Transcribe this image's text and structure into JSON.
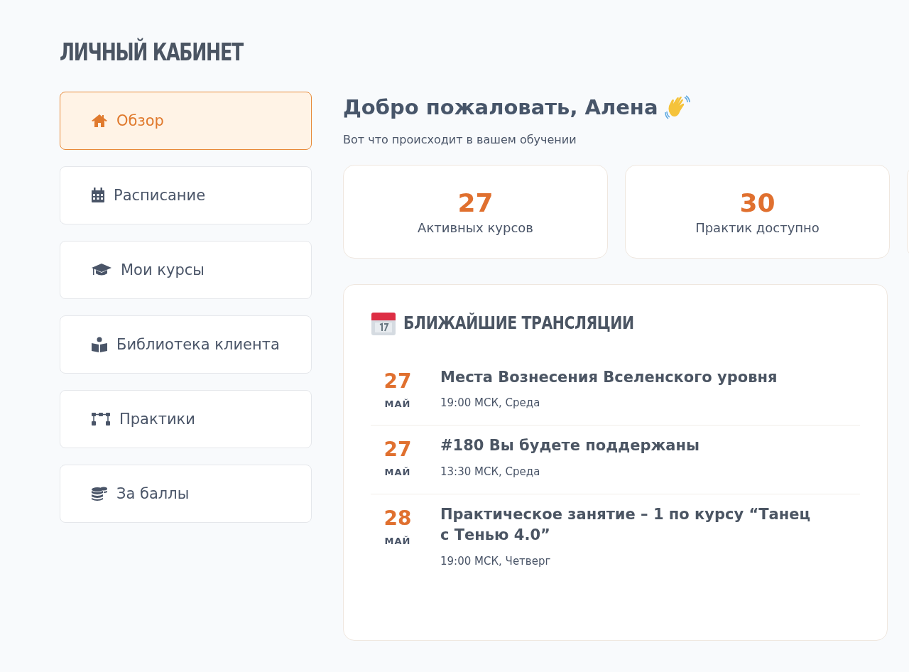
{
  "page_title": "ЛИЧНЫЙ КАБИНЕТ",
  "sidebar": {
    "items": [
      {
        "label": "Обзор",
        "kind": "home",
        "selected": true
      },
      {
        "label": "Расписание",
        "kind": "calendar",
        "selected": false
      },
      {
        "label": "Мои курсы",
        "kind": "cap",
        "selected": false
      },
      {
        "label": "Библиотека клиента",
        "kind": "reader",
        "selected": false
      },
      {
        "label": "Практики",
        "kind": "nodes",
        "selected": false
      },
      {
        "label": "За баллы",
        "kind": "coins",
        "selected": false
      }
    ]
  },
  "welcome": {
    "title": "Добро пожаловать, Алена",
    "subtitle": "Вот что происходит в вашем обучении"
  },
  "stats": [
    {
      "value": "27",
      "label": "Активных курсов"
    },
    {
      "value": "30",
      "label": "Практик доступно"
    }
  ],
  "broadcasts": {
    "title": "БЛИЖАЙШИЕ ТРАНСЛЯЦИИ",
    "events": [
      {
        "day": "27",
        "month": "МАЙ",
        "title": "Места Вознесения Вселенского уровня",
        "time": "19:00 МСК, Среда"
      },
      {
        "day": "27",
        "month": "МАЙ",
        "title": "#180 Вы будете поддержаны",
        "time": "13:30 МСК, Среда"
      },
      {
        "day": "28",
        "month": "МАЙ",
        "title": "Практическое занятие – 1 по курсу “Танец с Тенью 4.0”",
        "time": "19:00 МСК, Четверг"
      }
    ]
  }
}
